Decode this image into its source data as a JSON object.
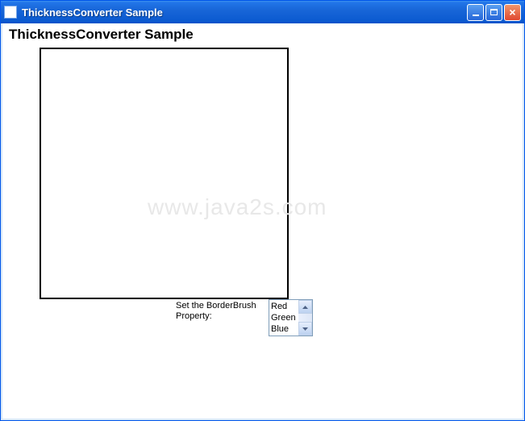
{
  "window": {
    "title": "ThicknessConverter Sample"
  },
  "heading": "ThicknessConverter Sample",
  "propertyLabel": "Set the BorderBrush Property:",
  "listbox": {
    "items": [
      "Red",
      "Green",
      "Blue"
    ]
  },
  "watermark": "www.java2s.com",
  "colors": {
    "titlebarBlue": "#1866d8",
    "closeRed": "#e04830",
    "borderBlack": "#000000",
    "listboxBorder": "#7f9db9"
  }
}
